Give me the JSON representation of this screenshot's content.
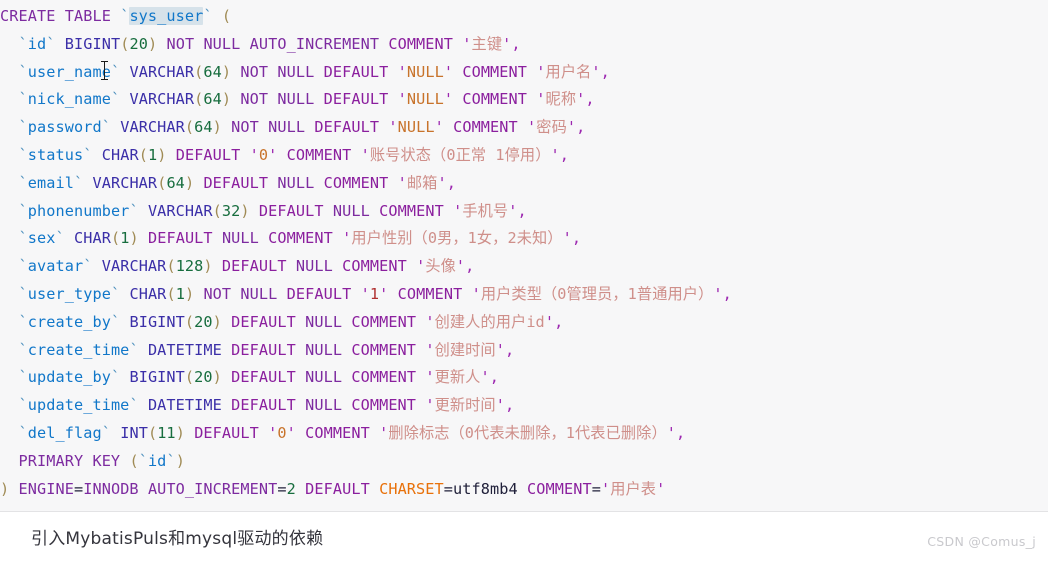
{
  "editor": {
    "language": "sql",
    "background_color": "#f7f7f8",
    "selection_color": "#d6e2ea",
    "selected_text": "sys_user",
    "cursor": "text-ibeam",
    "statement_label": "CREATE TABLE `sys_user`"
  },
  "syntax_colors": {
    "keyword": "#7d2ba0",
    "identifier": "#1177c9",
    "datatype": "#3b2fa8",
    "number": "#176d3e",
    "quote": "#9c27b0",
    "string_latin": "#c8732b",
    "string_cjk": "#cf8f8a",
    "charset_keyword": "#e8710a",
    "plain": "#20203a",
    "paren": "#a08b55"
  },
  "sql": {
    "header": {
      "create": "CREATE",
      "table": "TABLE",
      "table_name": "sys_user",
      "open_paren": "("
    },
    "columns": [
      {
        "name": "id",
        "type": "BIGINT",
        "length": "20",
        "constraints": "NOT NULL AUTO_INCREMENT",
        "comment": "主键",
        "trailing": ","
      },
      {
        "name": "user_name",
        "type": "VARCHAR",
        "length": "64",
        "constraints": "NOT NULL DEFAULT 'NULL'",
        "comment": "用户名",
        "trailing": ","
      },
      {
        "name": "nick_name",
        "type": "VARCHAR",
        "length": "64",
        "constraints": "NOT NULL DEFAULT 'NULL'",
        "comment": "昵称",
        "trailing": ","
      },
      {
        "name": "password",
        "type": "VARCHAR",
        "length": "64",
        "constraints": "NOT NULL DEFAULT 'NULL'",
        "comment": "密码",
        "trailing": ","
      },
      {
        "name": "status",
        "type": "CHAR",
        "length": "1",
        "constraints": "DEFAULT '0'",
        "comment": "账号状态（0正常 1停用）",
        "trailing": ","
      },
      {
        "name": "email",
        "type": "VARCHAR",
        "length": "64",
        "constraints": "DEFAULT NULL",
        "comment": "邮箱",
        "trailing": ","
      },
      {
        "name": "phonenumber",
        "type": "VARCHAR",
        "length": "32",
        "constraints": "DEFAULT NULL",
        "comment": "手机号",
        "trailing": ","
      },
      {
        "name": "sex",
        "type": "CHAR",
        "length": "1",
        "constraints": "DEFAULT NULL",
        "comment": "用户性别（0男，1女，2未知）",
        "trailing": ","
      },
      {
        "name": "avatar",
        "type": "VARCHAR",
        "length": "128",
        "constraints": "DEFAULT NULL",
        "comment": "头像",
        "trailing": ","
      },
      {
        "name": "user_type",
        "type": "CHAR",
        "length": "1",
        "constraints": "NOT NULL DEFAULT '1'",
        "comment": "用户类型（0管理员，1普通用户）",
        "trailing": ","
      },
      {
        "name": "create_by",
        "type": "BIGINT",
        "length": "20",
        "constraints": "DEFAULT NULL",
        "comment": "创建人的用户id",
        "trailing": ","
      },
      {
        "name": "create_time",
        "type": "DATETIME",
        "length": "",
        "constraints": "DEFAULT NULL",
        "comment": "创建时间",
        "trailing": ","
      },
      {
        "name": "update_by",
        "type": "BIGINT",
        "length": "20",
        "constraints": "DEFAULT NULL",
        "comment": "更新人",
        "trailing": ","
      },
      {
        "name": "update_time",
        "type": "DATETIME",
        "length": "",
        "constraints": "DEFAULT NULL",
        "comment": "更新时间",
        "trailing": ","
      },
      {
        "name": "del_flag",
        "type": "INT",
        "length": "11",
        "constraints": "DEFAULT '0'",
        "comment": "删除标志（0代表未删除，1代表已删除）",
        "trailing": ","
      }
    ],
    "primary_key": {
      "keyword": "PRIMARY KEY",
      "column": "id"
    },
    "table_options": {
      "close_paren": ")",
      "engine_key": "ENGINE",
      "engine_value": "INNODB",
      "auto_increment_key": "AUTO_INCREMENT",
      "auto_increment_value": "2",
      "default_keyword": "DEFAULT",
      "charset_key": "CHARSET",
      "charset_value": "utf8mb4",
      "comment_key": "COMMENT",
      "comment_value": "用户表"
    }
  },
  "caption": {
    "text": "引入MybatisPuls和mysql驱动的依赖"
  },
  "watermark": {
    "text": "CSDN @Comus_j"
  }
}
